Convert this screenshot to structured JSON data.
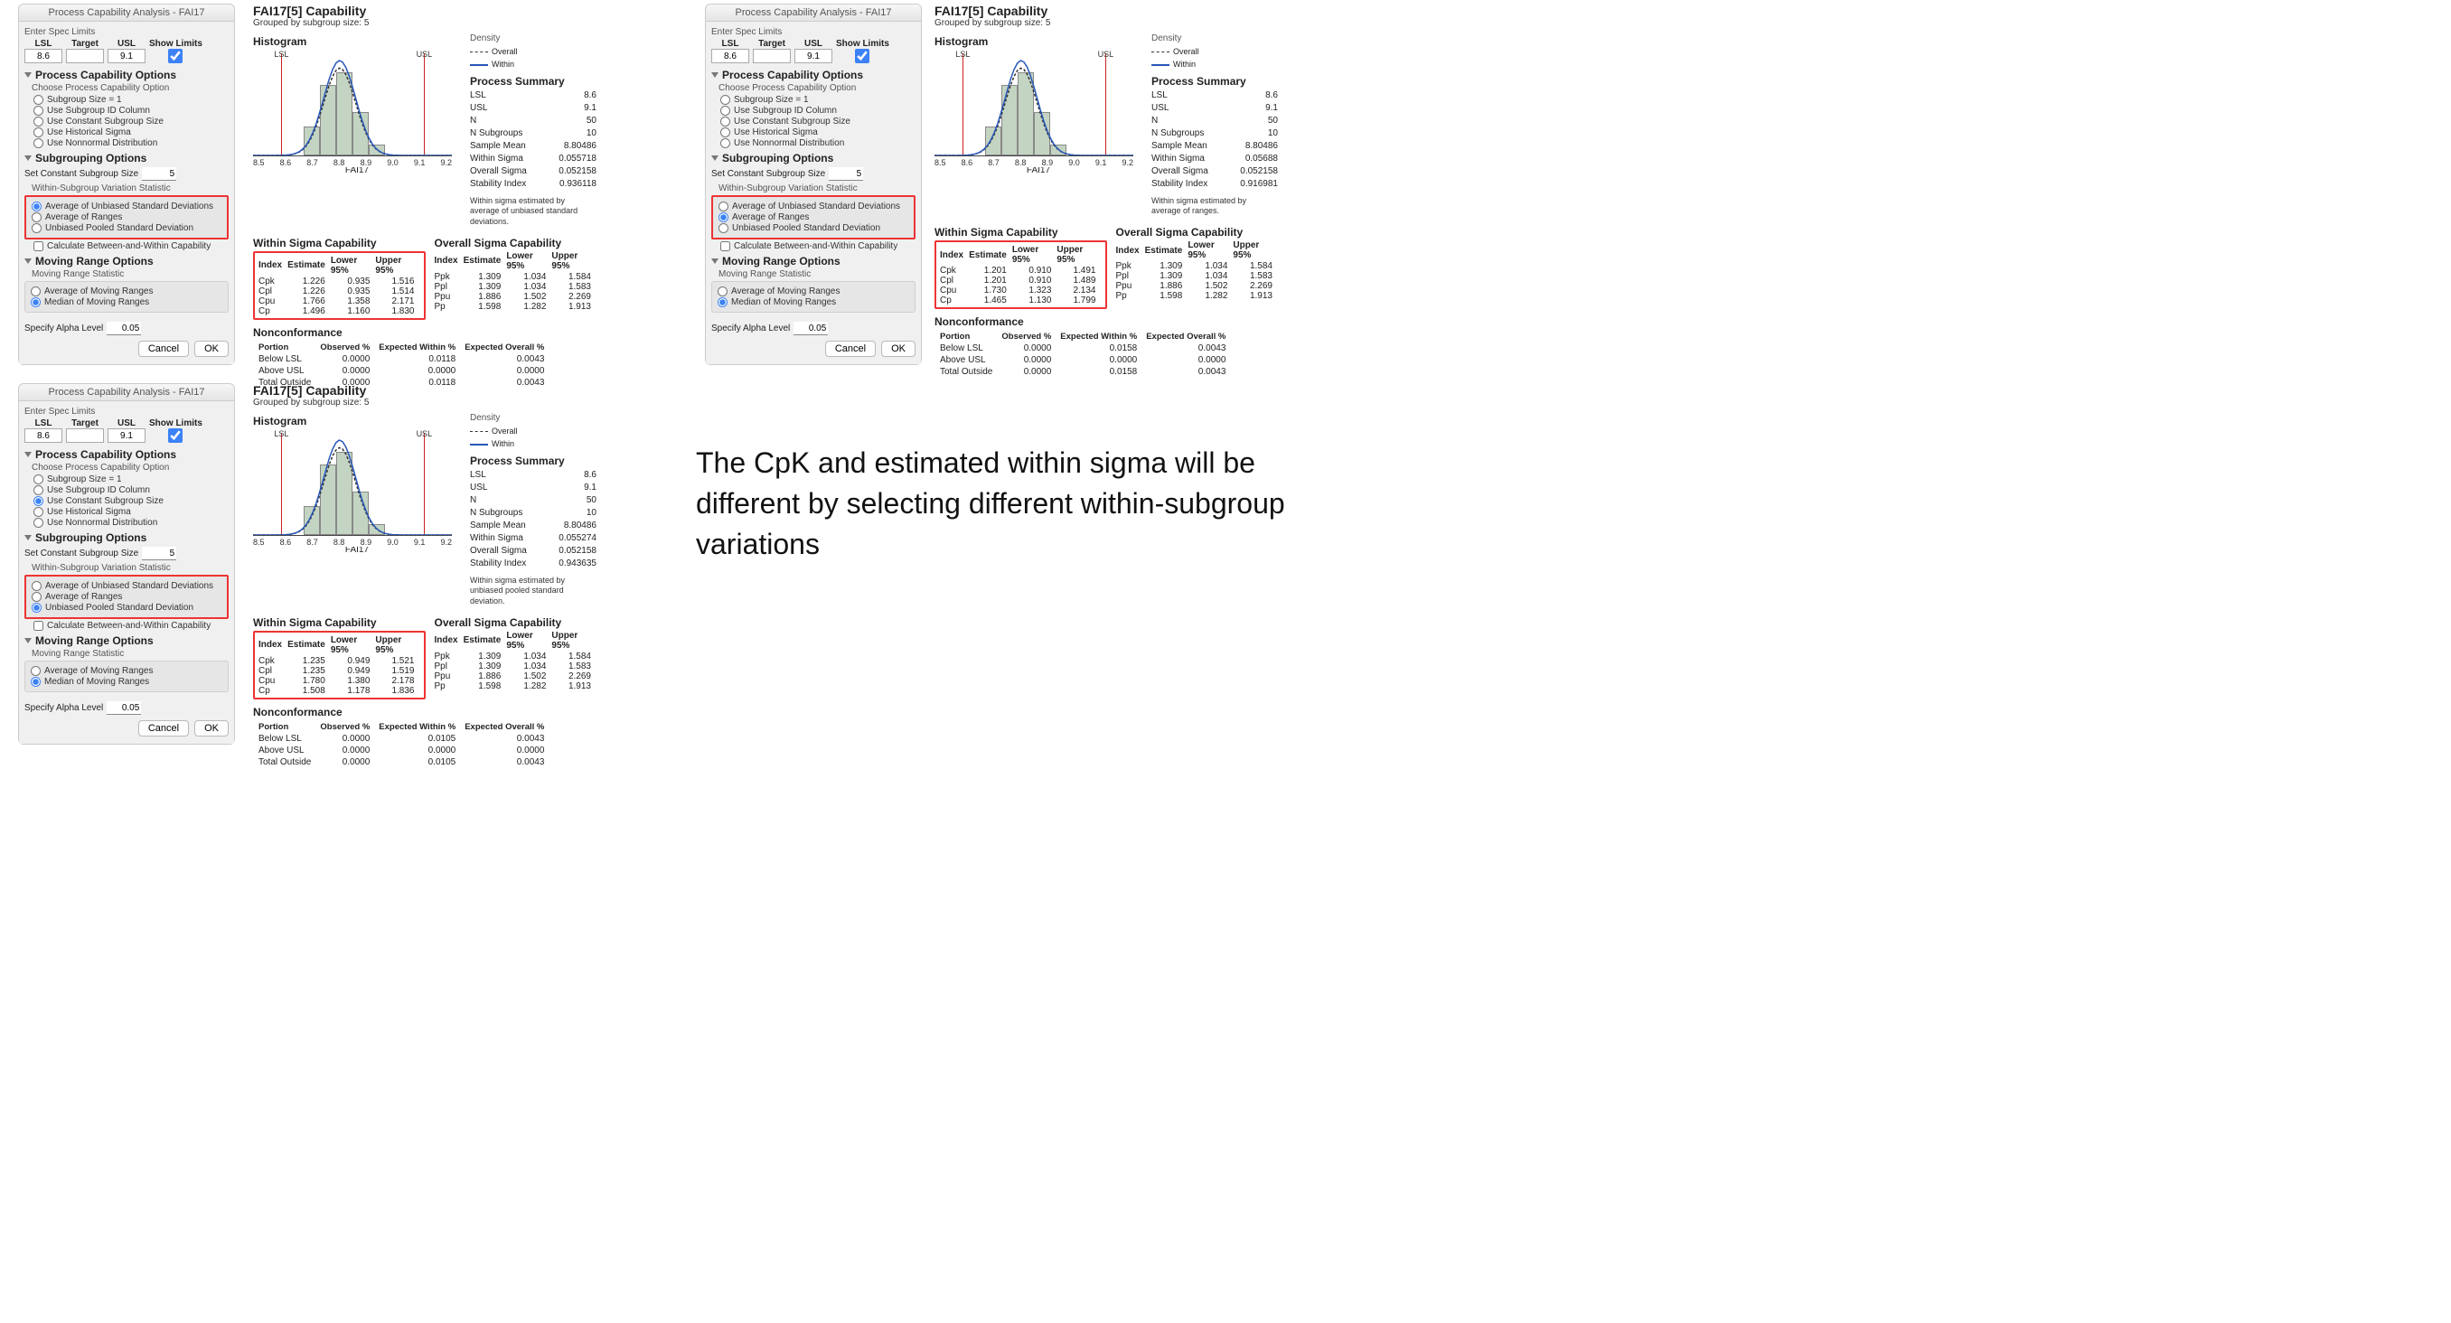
{
  "dialog": {
    "title": "Process Capability Analysis - FAI17",
    "enter_spec": "Enter Spec Limits",
    "lsl_hdr": "LSL",
    "target_hdr": "Target",
    "usl_hdr": "USL",
    "show_limits": "Show Limits",
    "lsl_val": "8.6",
    "target_val": "",
    "usl_val": "9.1",
    "pco_title": "Process Capability Options",
    "choose_option": "Choose Process Capability Option",
    "opt_sub1": "Subgroup Size = 1",
    "opt_useid": "Use Subgroup ID Column",
    "opt_const": "Use Constant Subgroup Size",
    "opt_hist": "Use Historical Sigma",
    "opt_nonnormal": "Use Nonnormal Distribution",
    "subgroup_title": "Subgrouping Options",
    "set_const": "Set Constant Subgroup Size",
    "set_const_val": "5",
    "stat_title": "Within-Subgroup Variation Statistic",
    "stat_avg_unbiased": "Average of Unbiased Standard Deviations",
    "stat_avg_ranges": "Average of Ranges",
    "stat_pooled": "Unbiased Pooled Standard Deviation",
    "calc_between": "Calculate Between-and-Within Capability",
    "moving_title": "Moving Range Options",
    "moving_stat": "Moving Range Statistic",
    "moving_avg": "Average of Moving Ranges",
    "moving_median": "Median of Moving Ranges",
    "alpha_lbl": "Specify Alpha Level",
    "alpha_val": "0.05",
    "cancel": "Cancel",
    "ok": "OK"
  },
  "report": {
    "title": "FAI17[5] Capability",
    "grouped": "Grouped by subgroup size: 5",
    "hist": "Histogram",
    "lsl": "LSL",
    "usl": "USL",
    "xlabel": "FAI17",
    "ticks": [
      "8.5",
      "8.6",
      "8.7",
      "8.8",
      "8.9",
      "9.0",
      "9.1",
      "9.2"
    ],
    "density": "Density",
    "legend_overall": "Overall",
    "legend_within": "Within",
    "ps_title": "Process Summary",
    "ws_title": "Within Sigma Capability",
    "os_title": "Overall Sigma Capability",
    "nc_title": "Nonconformance",
    "idx": "Index",
    "est": "Estimate",
    "l95": "Lower 95%",
    "u95": "Upper 95%",
    "portion": "Portion",
    "obs": "Observed %",
    "ewithin": "Expected Within %",
    "eoverall": "Expected Overall %",
    "below": "Below LSL",
    "above": "Above USL",
    "total": "Total Outside"
  },
  "panels": [
    {
      "selected_stat": "avg_unbiased",
      "summary": [
        [
          "LSL",
          "8.6"
        ],
        [
          "USL",
          "9.1"
        ],
        [
          "N",
          "50"
        ],
        [
          "N Subgroups",
          "10"
        ],
        [
          "Sample Mean",
          "8.80486"
        ],
        [
          "Within Sigma",
          "0.055718"
        ],
        [
          "Overall Sigma",
          "0.052158"
        ],
        [
          "Stability Index",
          "0.936118"
        ]
      ],
      "note": "Within sigma estimated by average of unbiased standard deviations.",
      "within": [
        [
          "Cpk",
          "1.226",
          "0.935",
          "1.516"
        ],
        [
          "Cpl",
          "1.226",
          "0.935",
          "1.514"
        ],
        [
          "Cpu",
          "1.766",
          "1.358",
          "2.171"
        ],
        [
          "Cp",
          "1.496",
          "1.160",
          "1.830"
        ]
      ],
      "overall": [
        [
          "Ppk",
          "1.309",
          "1.034",
          "1.584"
        ],
        [
          "Ppl",
          "1.309",
          "1.034",
          "1.583"
        ],
        [
          "Ppu",
          "1.886",
          "1.502",
          "2.269"
        ],
        [
          "Pp",
          "1.598",
          "1.282",
          "1.913"
        ]
      ],
      "nc": [
        [
          "Below LSL",
          "0.0000",
          "0.0118",
          "0.0043"
        ],
        [
          "Above USL",
          "0.0000",
          "0.0000",
          "0.0000"
        ],
        [
          "Total Outside",
          "0.0000",
          "0.0118",
          "0.0043"
        ]
      ]
    },
    {
      "selected_stat": "avg_ranges",
      "summary": [
        [
          "LSL",
          "8.6"
        ],
        [
          "USL",
          "9.1"
        ],
        [
          "N",
          "50"
        ],
        [
          "N Subgroups",
          "10"
        ],
        [
          "Sample Mean",
          "8.80486"
        ],
        [
          "Within Sigma",
          "0.05688"
        ],
        [
          "Overall Sigma",
          "0.052158"
        ],
        [
          "Stability Index",
          "0.916981"
        ]
      ],
      "note": "Within sigma estimated by average of ranges.",
      "within": [
        [
          "Cpk",
          "1.201",
          "0.910",
          "1.491"
        ],
        [
          "Cpl",
          "1.201",
          "0.910",
          "1.489"
        ],
        [
          "Cpu",
          "1.730",
          "1.323",
          "2.134"
        ],
        [
          "Cp",
          "1.465",
          "1.130",
          "1.799"
        ]
      ],
      "overall": [
        [
          "Ppk",
          "1.309",
          "1.034",
          "1.584"
        ],
        [
          "Ppl",
          "1.309",
          "1.034",
          "1.583"
        ],
        [
          "Ppu",
          "1.886",
          "1.502",
          "2.269"
        ],
        [
          "Pp",
          "1.598",
          "1.282",
          "1.913"
        ]
      ],
      "nc": [
        [
          "Below LSL",
          "0.0000",
          "0.0158",
          "0.0043"
        ],
        [
          "Above USL",
          "0.0000",
          "0.0000",
          "0.0000"
        ],
        [
          "Total Outside",
          "0.0000",
          "0.0158",
          "0.0043"
        ]
      ]
    },
    {
      "selected_stat": "pooled",
      "summary": [
        [
          "LSL",
          "8.6"
        ],
        [
          "USL",
          "9.1"
        ],
        [
          "N",
          "50"
        ],
        [
          "N Subgroups",
          "10"
        ],
        [
          "Sample Mean",
          "8.80486"
        ],
        [
          "Within Sigma",
          "0.055274"
        ],
        [
          "Overall Sigma",
          "0.052158"
        ],
        [
          "Stability Index",
          "0.943635"
        ]
      ],
      "note": "Within sigma estimated by unbiased pooled standard deviation.",
      "within": [
        [
          "Cpk",
          "1.235",
          "0.949",
          "1.521"
        ],
        [
          "Cpl",
          "1.235",
          "0.949",
          "1.519"
        ],
        [
          "Cpu",
          "1.780",
          "1.380",
          "2.178"
        ],
        [
          "Cp",
          "1.508",
          "1.178",
          "1.836"
        ]
      ],
      "overall": [
        [
          "Ppk",
          "1.309",
          "1.034",
          "1.584"
        ],
        [
          "Ppl",
          "1.309",
          "1.034",
          "1.583"
        ],
        [
          "Ppu",
          "1.886",
          "1.502",
          "2.269"
        ],
        [
          "Pp",
          "1.598",
          "1.282",
          "1.913"
        ]
      ],
      "nc": [
        [
          "Below LSL",
          "0.0000",
          "0.0105",
          "0.0043"
        ],
        [
          "Above USL",
          "0.0000",
          "0.0000",
          "0.0000"
        ],
        [
          "Total Outside",
          "0.0000",
          "0.0105",
          "0.0043"
        ]
      ]
    }
  ],
  "chart_data": {
    "type": "bar",
    "xlabel": "FAI17",
    "x_ticks": [
      8.5,
      8.6,
      8.7,
      8.8,
      8.9,
      9.0,
      9.1,
      9.2
    ],
    "lsl": 8.6,
    "usl": 9.1,
    "bars": [
      {
        "x": 8.75,
        "h": 32
      },
      {
        "x": 8.8,
        "h": 78
      },
      {
        "x": 8.85,
        "h": 92
      },
      {
        "x": 8.9,
        "h": 48
      },
      {
        "x": 8.95,
        "h": 12
      }
    ],
    "overlays": [
      "Overall (normal, dashed)",
      "Within (normal, blue)"
    ]
  },
  "annotation": "The CpK and estimated within sigma will be different by selecting different within-subgroup variations"
}
